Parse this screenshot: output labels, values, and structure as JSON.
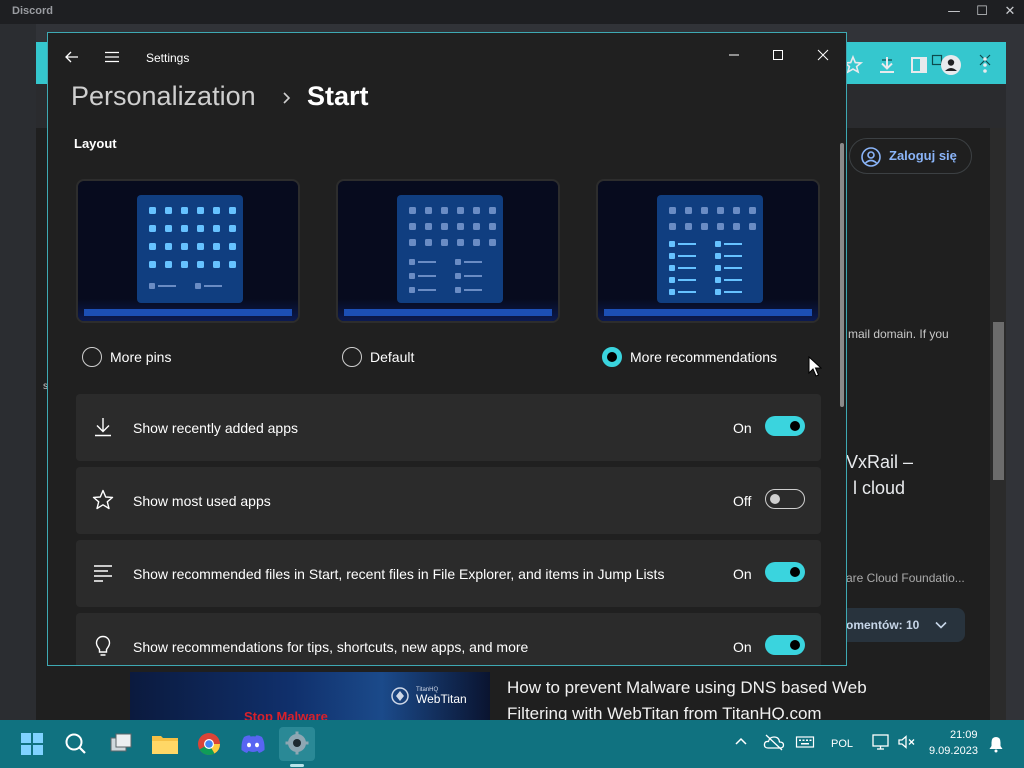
{
  "discord": {
    "title": "Discord",
    "minimize": "—",
    "maximize": "☐",
    "close": "✕"
  },
  "browser": {
    "login_button": "Zaloguj się",
    "partial_text_email": "mail domain. If you",
    "partial_text_s": "s",
    "partial_heading_line1": "VxRail –",
    "partial_heading_line2": "l cloud",
    "partial_subtext": "are Cloud Foundatio...",
    "comments_label": "omentów: 10",
    "video_title": "How to prevent Malware using DNS based Web Filtering with WebTitan from TitanHQ.com",
    "thumbnail_brand": "WebTitan",
    "thumbnail_brand_small": "TitanHQ",
    "thumbnail_caption": "Stop Malware"
  },
  "settings": {
    "window_title": "Settings",
    "breadcrumb_parent": "Personalization",
    "breadcrumb_current": "Start",
    "layout_heading": "Layout",
    "layout_options": [
      {
        "label": "More pins",
        "selected": false
      },
      {
        "label": "Default",
        "selected": false
      },
      {
        "label": "More recommendations",
        "selected": true
      }
    ],
    "toggles": [
      {
        "label": "Show recently added apps",
        "state": "On",
        "on": true,
        "icon": "download-icon"
      },
      {
        "label": "Show most used apps",
        "state": "Off",
        "on": false,
        "icon": "star-icon"
      },
      {
        "label": "Show recommended files in Start, recent files in File Explorer, and items in Jump Lists",
        "state": "On",
        "on": true,
        "icon": "list-icon"
      },
      {
        "label": "Show recommendations for tips, shortcuts, new apps, and more",
        "state": "On",
        "on": true,
        "icon": "lightbulb-icon"
      }
    ]
  },
  "taskbar": {
    "apps": [
      "start-icon",
      "search-icon",
      "task-view-icon",
      "file-explorer-icon",
      "chrome-icon",
      "discord-icon",
      "settings-icon"
    ],
    "language": "POL",
    "time": "21:09",
    "date": "9.09.2023"
  },
  "colors": {
    "accent": "#3ad4de",
    "taskbar": "#107280",
    "card": "#2b2b2b",
    "window_bg": "#202020"
  }
}
